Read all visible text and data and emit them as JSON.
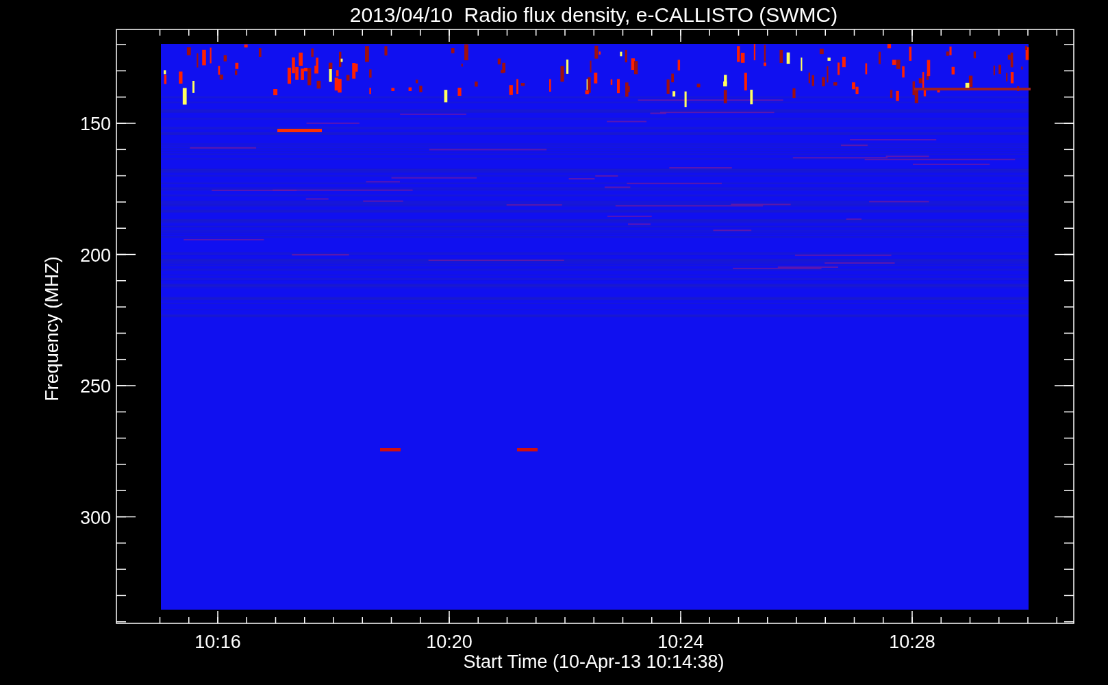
{
  "title": "2013/04/10  Radio flux density, e-CALLISTO (SWMC)",
  "y_axis": {
    "label": "Frequency (MHZ)",
    "ticks": [
      "150",
      "200",
      "250",
      "300"
    ]
  },
  "x_axis": {
    "label": "Start Time (10-Apr-13 10:14:38)",
    "ticks": [
      "10:16",
      "10:20",
      "10:24",
      "10:28"
    ]
  }
}
